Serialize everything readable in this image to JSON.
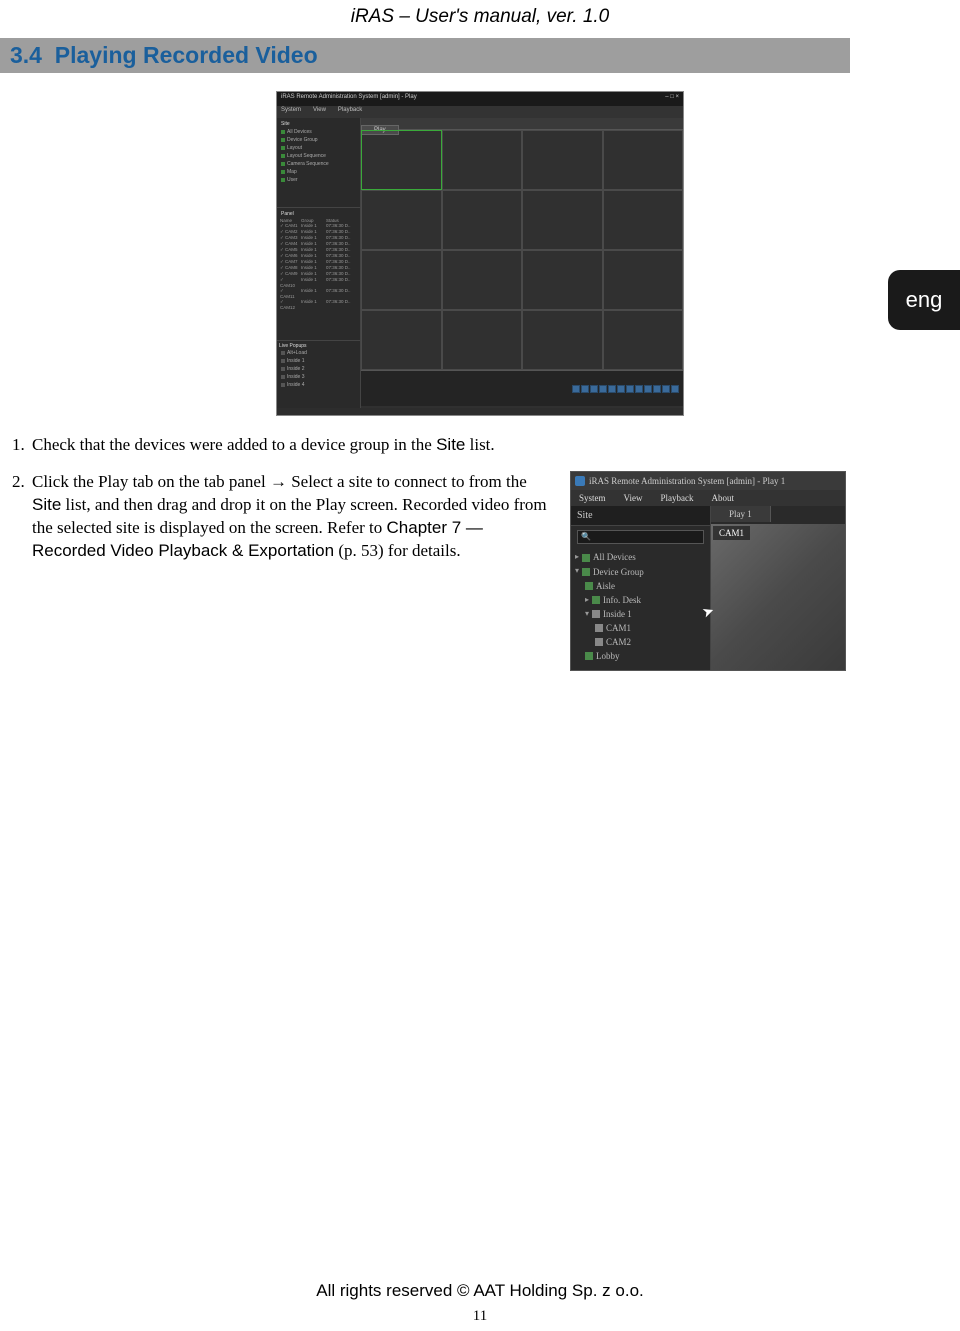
{
  "header": {
    "title": "iRAS – User's manual, ver. 1.0"
  },
  "section": {
    "number": "3.4",
    "title": "Playing Recorded Video"
  },
  "lang_tab": "eng",
  "screenshot1": {
    "window_title": "iRAS Remote Administration System [admin] - Play",
    "menu": [
      "System",
      "View",
      "Playback"
    ],
    "site_label": "Site",
    "side_items": [
      "All Devices",
      "Device Group",
      "Layout",
      "Layout Sequence",
      "Camera Sequence",
      "Map",
      "User"
    ],
    "panel_label": "Panel",
    "list_header": [
      "Name",
      "Group",
      "Status"
    ],
    "list_rows": [
      {
        "n": "CAM1",
        "g": "Inside 1",
        "s": "07:36:30 D.."
      },
      {
        "n": "CAM2",
        "g": "Inside 1",
        "s": "07:36:30 D.."
      },
      {
        "n": "CAM3",
        "g": "Inside 1",
        "s": "07:36:30 D.."
      },
      {
        "n": "CAM4",
        "g": "Inside 1",
        "s": "07:36:30 D.."
      },
      {
        "n": "CAM5",
        "g": "Inside 1",
        "s": "07:36:30 D.."
      },
      {
        "n": "CAM6",
        "g": "Inside 1",
        "s": "07:36:30 D.."
      },
      {
        "n": "CAM7",
        "g": "Inside 1",
        "s": "07:36:30 D.."
      },
      {
        "n": "CAM8",
        "g": "Inside 1",
        "s": "07:36:30 D.."
      },
      {
        "n": "CAM9",
        "g": "Inside 1",
        "s": "07:36:30 D.."
      },
      {
        "n": "CAM10",
        "g": "Inside 1",
        "s": "07:36:30 D.."
      },
      {
        "n": "CAM11",
        "g": "Inside 1",
        "s": "07:36:30 D.."
      },
      {
        "n": "CAM12",
        "g": "Inside 1",
        "s": "07:36:30 D.."
      }
    ],
    "live_label": "Live Popups",
    "live_rows": [
      "Alt+Load",
      "Inside 1",
      "Inside 2",
      "Inside 3",
      "Inside 4"
    ],
    "tab": "Play"
  },
  "steps": {
    "s1_pre": "Check that the devices were added to a device group in the ",
    "s1_site": "Site",
    "s1_post": " list.",
    "s2_a": "Click the Play tab on the tab panel → Select a site to connect to from the ",
    "s2_site": "Site",
    "s2_b": " list, and then drag and drop it on the Play screen.  Recorded video from the selected site is displayed on the screen.  Refer to ",
    "s2_chapter": "Chapter 7 — Recorded Video Playback & Exportation",
    "s2_c": " (p. 53) for details."
  },
  "screenshot2": {
    "window_title": "iRAS Remote Administration System [admin] - Play 1",
    "menu": [
      "System",
      "View",
      "Playback",
      "About"
    ],
    "site_label": "Site",
    "tab": "Play 1",
    "cam_label": "CAM1",
    "tree": {
      "all_devices": "All Devices",
      "device_group": "Device Group",
      "aisle": "Aisle",
      "info_desk": "Info. Desk",
      "inside1": "Inside 1",
      "cam1": "CAM1",
      "cam2": "CAM2",
      "lobby": "Lobby"
    }
  },
  "footer": "All rights reserved © AAT Holding Sp. z o.o.",
  "page_number": "11"
}
